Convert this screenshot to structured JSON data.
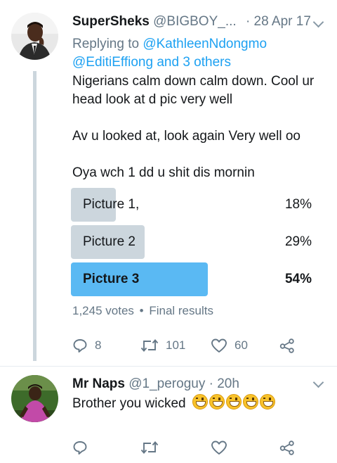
{
  "tweet": {
    "name": "SuperSheks",
    "handle": "@BIGBOY_...",
    "time": "· 28 Apr 17",
    "replying_prefix": "Replying to ",
    "replying_mention": "@KathleenNdongmo",
    "replying_line2_mention": "@EditiEffiong",
    "replying_line2_rest": " and 3 others",
    "text_lines": [
      "Nigerians calm down calm down. Cool ur",
      "head look at d pic very well",
      "Av u looked at, look again Very well oo",
      "Oya wch 1 dd u shit dis mornin"
    ],
    "poll": {
      "options": [
        {
          "label": "Picture 1,",
          "percent": "18%",
          "value": 18
        },
        {
          "label": "Picture 2",
          "percent": "29%",
          "value": 29
        },
        {
          "label": "Picture 3",
          "percent": "54%",
          "value": 54,
          "winner": true
        }
      ],
      "votes": "1,245 votes",
      "status": "Final results",
      "separator": "•"
    },
    "actions": {
      "replies": "8",
      "retweets": "101",
      "likes": "60"
    }
  },
  "reply": {
    "name": "Mr Naps",
    "handle": "@1_peroguy",
    "time": "· 20h",
    "text": "Brother you wicked",
    "emoji_count": 5,
    "emoji_name": "grinning-squinting-face"
  },
  "colors": {
    "accent": "#1da1f2",
    "poll_winner": "#5ab9f3",
    "poll_other": "#ccd6dd",
    "muted": "#657786"
  }
}
